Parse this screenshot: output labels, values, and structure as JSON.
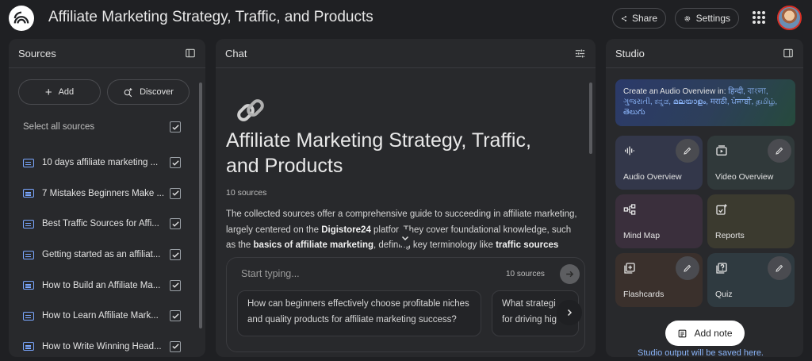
{
  "header": {
    "title": "Affiliate Marketing Strategy, Traffic, and Products",
    "share_label": "Share",
    "settings_label": "Settings"
  },
  "sources": {
    "title": "Sources",
    "add_label": "Add",
    "discover_label": "Discover",
    "select_all_label": "Select all sources",
    "items": [
      {
        "label": "10 days affiliate marketing ..."
      },
      {
        "label": "7 Mistakes Beginners Make ..."
      },
      {
        "label": "Best Traffic Sources for Affi..."
      },
      {
        "label": "Getting started as an affiliat..."
      },
      {
        "label": "How to Build an Affiliate Ma..."
      },
      {
        "label": "How to Learn Affiliate Mark..."
      },
      {
        "label": "How to Write Winning Head..."
      }
    ]
  },
  "chat": {
    "title": "Chat",
    "notebook_title": "Affiliate Marketing Strategy, Traffic, and Products",
    "source_count": "10 sources",
    "summary_part1": "The collected sources offer a comprehensive guide to succeeding in affiliate marketing, largely centered on the ",
    "summary_bold1": "Digistore24",
    "summary_part2": " platfor",
    "summary_part3": ". They cover foundational knowledge, such as the ",
    "summary_bold2": "basics of affiliate marketing",
    "summary_part4": ", defining key terminology like ",
    "summary_bold3": "traffic sources",
    "input_placeholder": "Start typing...",
    "input_source_count": "10 sources",
    "suggestions": [
      "How can beginners effectively choose profitable niches and quality products for affiliate marketing success?",
      "What strategi for driving hig"
    ]
  },
  "studio": {
    "title": "Studio",
    "audio_prompt": "Create an Audio Overview in:",
    "languages": "हिन्दी, বাংলা, ગુજરાતી, ಕನ್ನಡ, മലയാളം, मराठी, ਪੰਜਾਬੀ, தமிழ், తెలుగు",
    "cards": {
      "audio": "Audio Overview",
      "video": "Video Overview",
      "mindmap": "Mind Map",
      "reports": "Reports",
      "flashcards": "Flashcards",
      "quiz": "Quiz"
    },
    "add_note_label": "Add note",
    "footer": "Studio output will be saved here."
  }
}
